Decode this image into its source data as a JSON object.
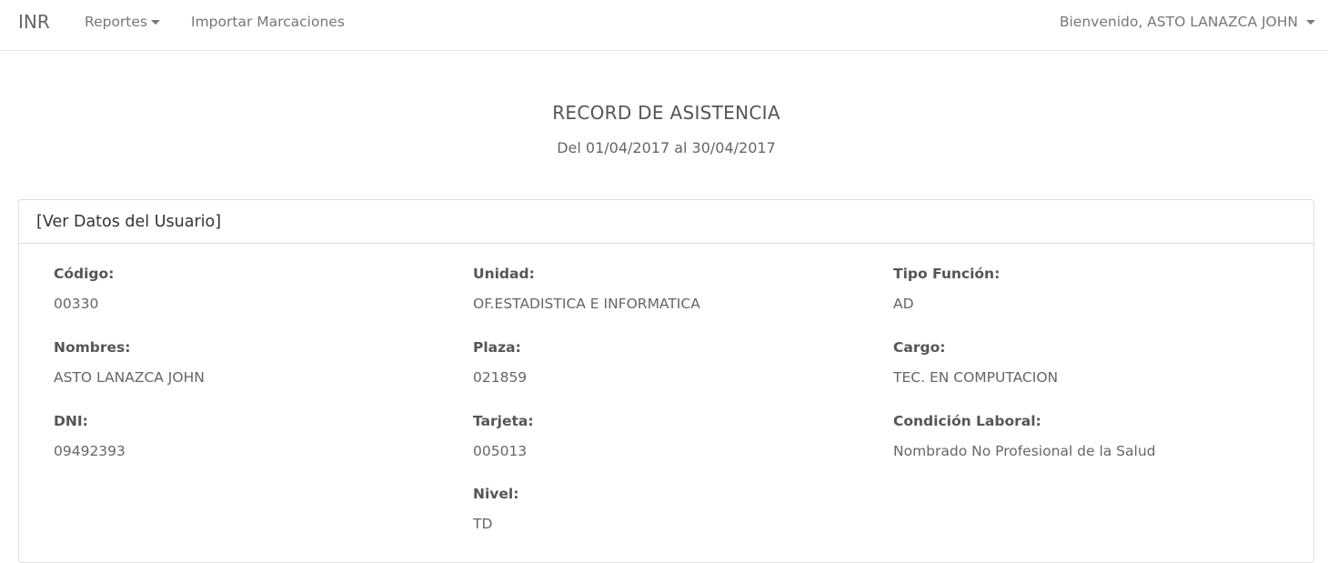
{
  "navbar": {
    "brand": "INR",
    "menu": {
      "reportes": "Reportes",
      "importar": "Importar Marcaciones"
    },
    "user_greeting": "Bienvenido, ASTO LANAZCA JOHN"
  },
  "header": {
    "title": "RECORD DE ASISTENCIA",
    "range": "Del 01/04/2017 al 30/04/2017"
  },
  "panel": {
    "toggle_label": "[Ver Datos del Usuario]",
    "fields": {
      "codigo": {
        "label": "Código:",
        "value": "00330"
      },
      "unidad": {
        "label": "Unidad:",
        "value": "OF.ESTADISTICA E INFORMATICA"
      },
      "tipo_funcion": {
        "label": "Tipo Función:",
        "value": "AD"
      },
      "nombres": {
        "label": "Nombres:",
        "value": "ASTO LANAZCA JOHN"
      },
      "plaza": {
        "label": "Plaza:",
        "value": "021859"
      },
      "cargo": {
        "label": "Cargo:",
        "value": "TEC. EN COMPUTACION"
      },
      "dni": {
        "label": "DNI:",
        "value": "09492393"
      },
      "tarjeta": {
        "label": "Tarjeta:",
        "value": "005013"
      },
      "condicion_laboral": {
        "label": "Condición Laboral:",
        "value": "Nombrado No Profesional de la Salud"
      },
      "nivel": {
        "label": "Nivel:",
        "value": "TD"
      }
    }
  }
}
